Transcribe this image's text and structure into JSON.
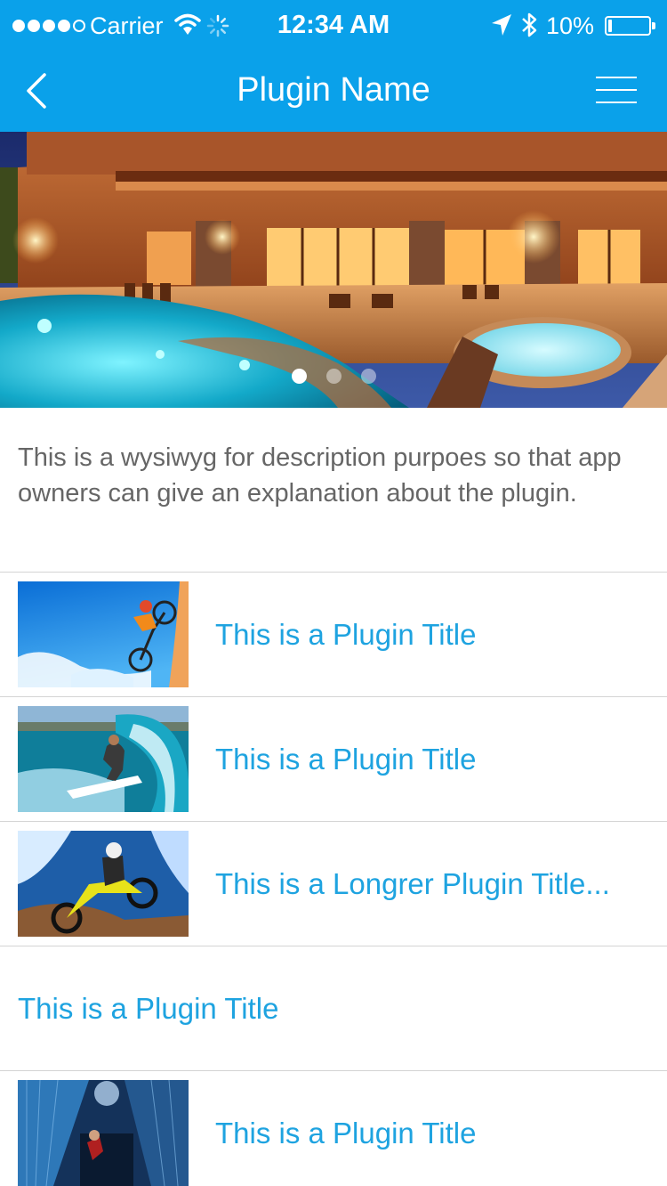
{
  "status_bar": {
    "carrier": "Carrier",
    "time": "12:34 AM",
    "battery": "10%",
    "battery_level": 0.1
  },
  "nav": {
    "title": "Plugin Name",
    "back_icon": "chevron-left-icon",
    "menu_icon": "hamburger-menu-icon"
  },
  "carousel": {
    "slide_count": 3,
    "active_index": 0
  },
  "description": "This is a wysiwyg for description purpoes so that app owners can give an explanation about the plugin.",
  "items": [
    {
      "title": "This is a Plugin Title",
      "has_image": true
    },
    {
      "title": "This is a Plugin Title",
      "has_image": true
    },
    {
      "title": "This is a Longrer Plugin Title...",
      "has_image": true
    },
    {
      "title": "This is a Plugin Title",
      "has_image": false
    },
    {
      "title": "This is a Plugin Title",
      "has_image": true
    }
  ],
  "colors": {
    "brand": "#0aa1ea",
    "link": "#1ea3e0",
    "body_text": "#666666",
    "divider": "#d4d4d4"
  }
}
